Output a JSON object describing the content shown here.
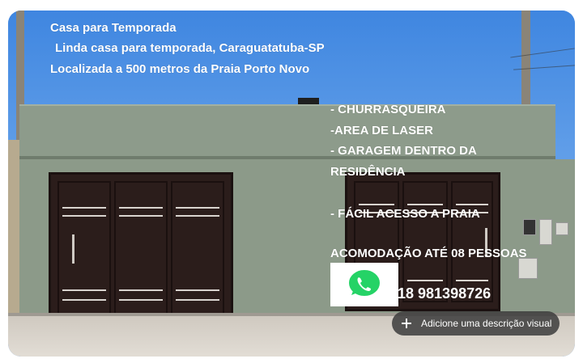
{
  "listing_photo": {
    "header": {
      "title": "Casa para Temporada",
      "line1": "Linda casa para temporada, Caraguatatuba-SP",
      "line2": "Localizada a 500  metros da Praia Porto Novo"
    },
    "features": [
      "- CHURRASQUEIRA",
      "-AREA DE LASER",
      "- GARAGEM DENTRO DA",
      "RESIDÊNCIA",
      "- FÁCIL ACESSO A PRAIA",
      "ACOMODAÇÃO ATÉ 08 PESSOAS"
    ],
    "contact": {
      "icon": "whatsapp-icon",
      "phone": "18 981398726"
    }
  },
  "actions": {
    "add_visual_description_label": "Adicione uma descrição visual",
    "add_icon": "plus-icon"
  },
  "colors": {
    "whatsapp_green": "#25d366",
    "button_bg": "#3c3c3c",
    "gate_brown": "#2b1d1b",
    "wall_green": "#8c9a89"
  }
}
